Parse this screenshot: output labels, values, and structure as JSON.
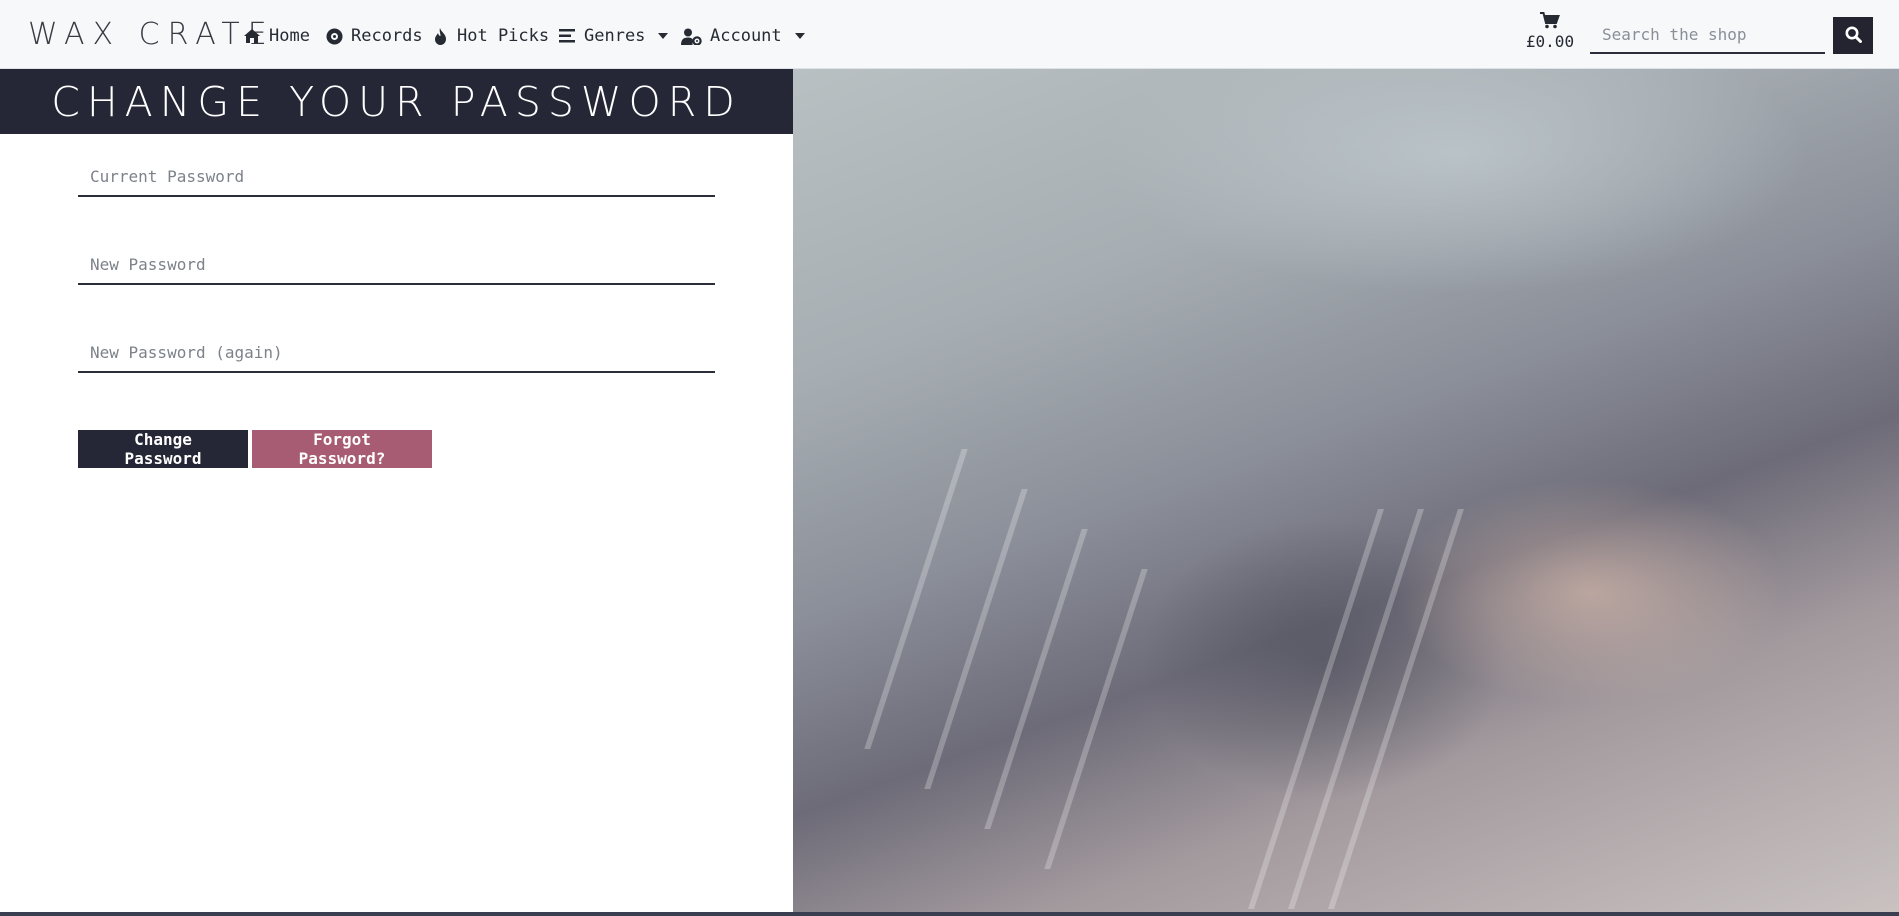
{
  "brand": "WAX CRATE",
  "nav": {
    "home": "Home",
    "records": "Records",
    "hot_picks": "Hot Picks",
    "genres": "Genres",
    "account": "Account"
  },
  "cart": {
    "total": "£0.00",
    "icon": "cart-icon"
  },
  "search": {
    "placeholder": "Search the shop",
    "icon": "search-icon"
  },
  "page_title": "CHANGE YOUR PASSWORD",
  "form": {
    "current_password_placeholder": "Current Password",
    "new_password_placeholder": "New Password",
    "new_password_again_placeholder": "New Password (again)",
    "submit_label": "Change Password",
    "forgot_label": "Forgot Password?"
  },
  "colors": {
    "dark": "#252636",
    "accent": "#a85c74",
    "navbar_bg": "#f6f8fa"
  }
}
